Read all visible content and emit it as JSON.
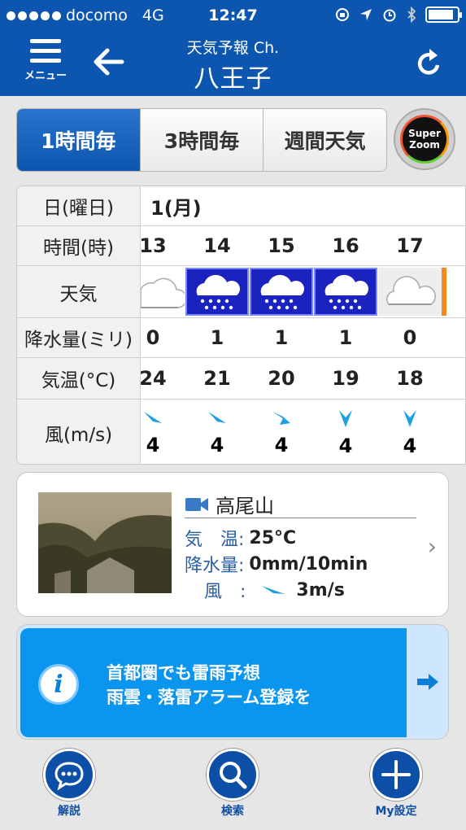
{
  "status": {
    "carrier": "docomo",
    "network": "4G",
    "time": "12:47"
  },
  "header": {
    "menu_label": "メニュー",
    "subtitle": "天気予報 Ch.",
    "title": "八王子"
  },
  "tabs": [
    {
      "label": "1時間毎",
      "active": true
    },
    {
      "label": "3時間毎",
      "active": false
    },
    {
      "label": "週間天気",
      "active": false
    }
  ],
  "super_zoom": {
    "line1": "Super",
    "line2": "Zoom"
  },
  "forecast": {
    "row_labels": {
      "date": "日(曜日)",
      "time": "時間(時)",
      "weather": "天気",
      "precip": "降水量(ミリ)",
      "temp": "気温(°C)",
      "wind": "風(m/s)"
    },
    "date": "1(月)",
    "hours": [
      {
        "time": "13",
        "weather": "cloudy",
        "precip": "0",
        "temp": "24",
        "wind_dir": "NE",
        "wind": "4"
      },
      {
        "time": "14",
        "weather": "rain",
        "precip": "1",
        "temp": "21",
        "wind_dir": "NE",
        "wind": "4"
      },
      {
        "time": "15",
        "weather": "rain",
        "precip": "1",
        "temp": "20",
        "wind_dir": "NW",
        "wind": "4"
      },
      {
        "time": "16",
        "weather": "rain",
        "precip": "1",
        "temp": "19",
        "wind_dir": "N",
        "wind": "4"
      },
      {
        "time": "17",
        "weather": "cloudy",
        "precip": "0",
        "temp": "18",
        "wind_dir": "N",
        "wind": "4"
      }
    ]
  },
  "live": {
    "location": "高尾山",
    "temp_label": "気　温:",
    "temp_value": "25°C",
    "precip_label": "降水量:",
    "precip_value": "0mm/10min",
    "wind_label": "風　:",
    "wind_value": "3m/s"
  },
  "banner": {
    "line1": "首都圏でも雷雨予想",
    "line2": "雨雲・落雷アラーム登録を"
  },
  "bottom_nav": [
    {
      "label": "解説",
      "icon": "speech-bubble-icon"
    },
    {
      "label": "検索",
      "icon": "magnifier-icon"
    },
    {
      "label": "My設定",
      "icon": "plus-icon"
    }
  ],
  "colors": {
    "header": "#0d56b0",
    "rain_cell": "#1a22c0",
    "banner": "#0a95ef",
    "wind_arrow": "#1e9fe0"
  }
}
